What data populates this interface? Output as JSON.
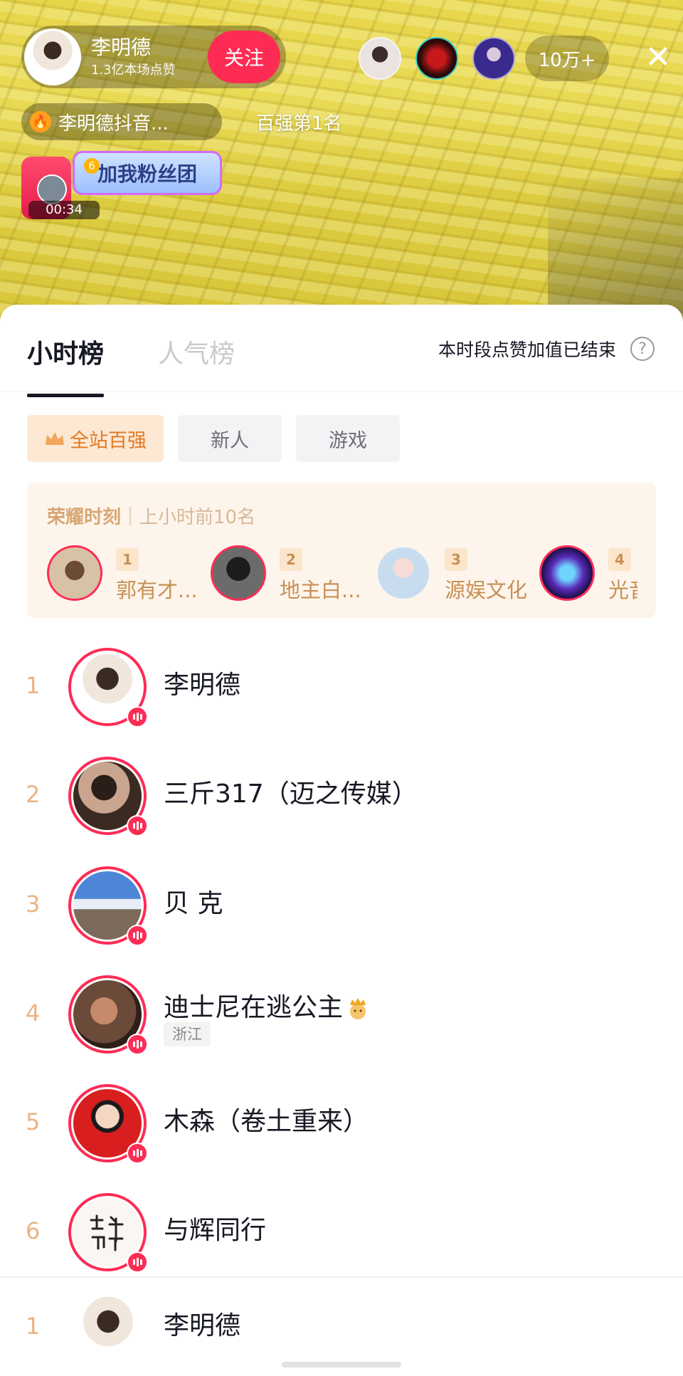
{
  "live": {
    "host": {
      "name": "李明德",
      "likes": "1.3亿本场点赞",
      "follow_label": "关注"
    },
    "viewer_count": "10万+",
    "shop_label": "李明德抖音...",
    "rank_tag": "百强第1名",
    "fan_group": {
      "level": "6",
      "label": "加我粉丝团",
      "timer": "00:34"
    }
  },
  "sheet": {
    "tabs": [
      {
        "label": "小时榜",
        "active": true
      },
      {
        "label": "人气榜",
        "active": false
      }
    ],
    "notice": "本时段点赞加值已结束",
    "filters": [
      {
        "label": "全站百强",
        "active": true
      },
      {
        "label": "新人"
      },
      {
        "label": "游戏"
      }
    ],
    "glory": {
      "title": "荣耀时刻",
      "subtitle": "上小时前10名",
      "items": [
        {
          "rank": "1",
          "name": "郭有才..."
        },
        {
          "rank": "2",
          "name": "地主白..."
        },
        {
          "rank": "3",
          "name": "源娱文化"
        },
        {
          "rank": "4",
          "name": "光音"
        }
      ]
    },
    "list": [
      {
        "rank": "1",
        "name": "李明德"
      },
      {
        "rank": "2",
        "name": "三斤317（迈之传媒）"
      },
      {
        "rank": "3",
        "name": "贝 克"
      },
      {
        "rank": "4",
        "name": "迪士尼在逃公主",
        "tag": "浙江"
      },
      {
        "rank": "5",
        "name": "木森（卷土重来）"
      },
      {
        "rank": "6",
        "name": "与辉同行"
      }
    ],
    "self": {
      "rank": "1",
      "name": "李明德"
    }
  },
  "colors": {
    "accent": "#fe2c55",
    "rank_gold": "#e9b484",
    "glory_bg": "#fdf5ec"
  }
}
